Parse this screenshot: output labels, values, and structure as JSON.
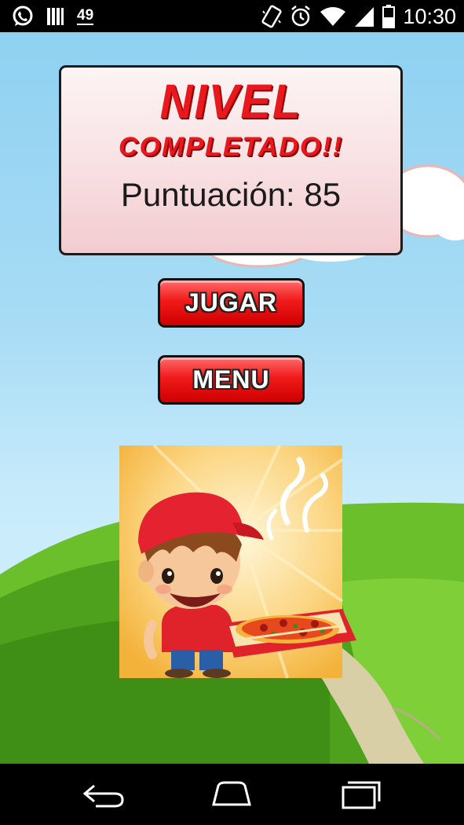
{
  "status_bar": {
    "notification_count": "49",
    "time": "10:30",
    "icons": [
      "whatsapp-icon",
      "bars-icon",
      "vibrate-icon",
      "alarm-icon",
      "wifi-icon",
      "signal-icon",
      "battery-icon"
    ]
  },
  "result_panel": {
    "title_line1": "NIVEL",
    "title_line2": "COMPLETADO!!",
    "score_text": "Puntuación: 85"
  },
  "buttons": {
    "play_label": "JUGAR",
    "menu_label": "MENU"
  },
  "nav_bar": {
    "icons": [
      "back-icon",
      "home-icon",
      "recent-apps-icon"
    ]
  },
  "colors": {
    "title_red": "#e8181e",
    "button_red": "#f01a1a",
    "sky": "#8fd1f1",
    "grass": "#4da11c"
  }
}
